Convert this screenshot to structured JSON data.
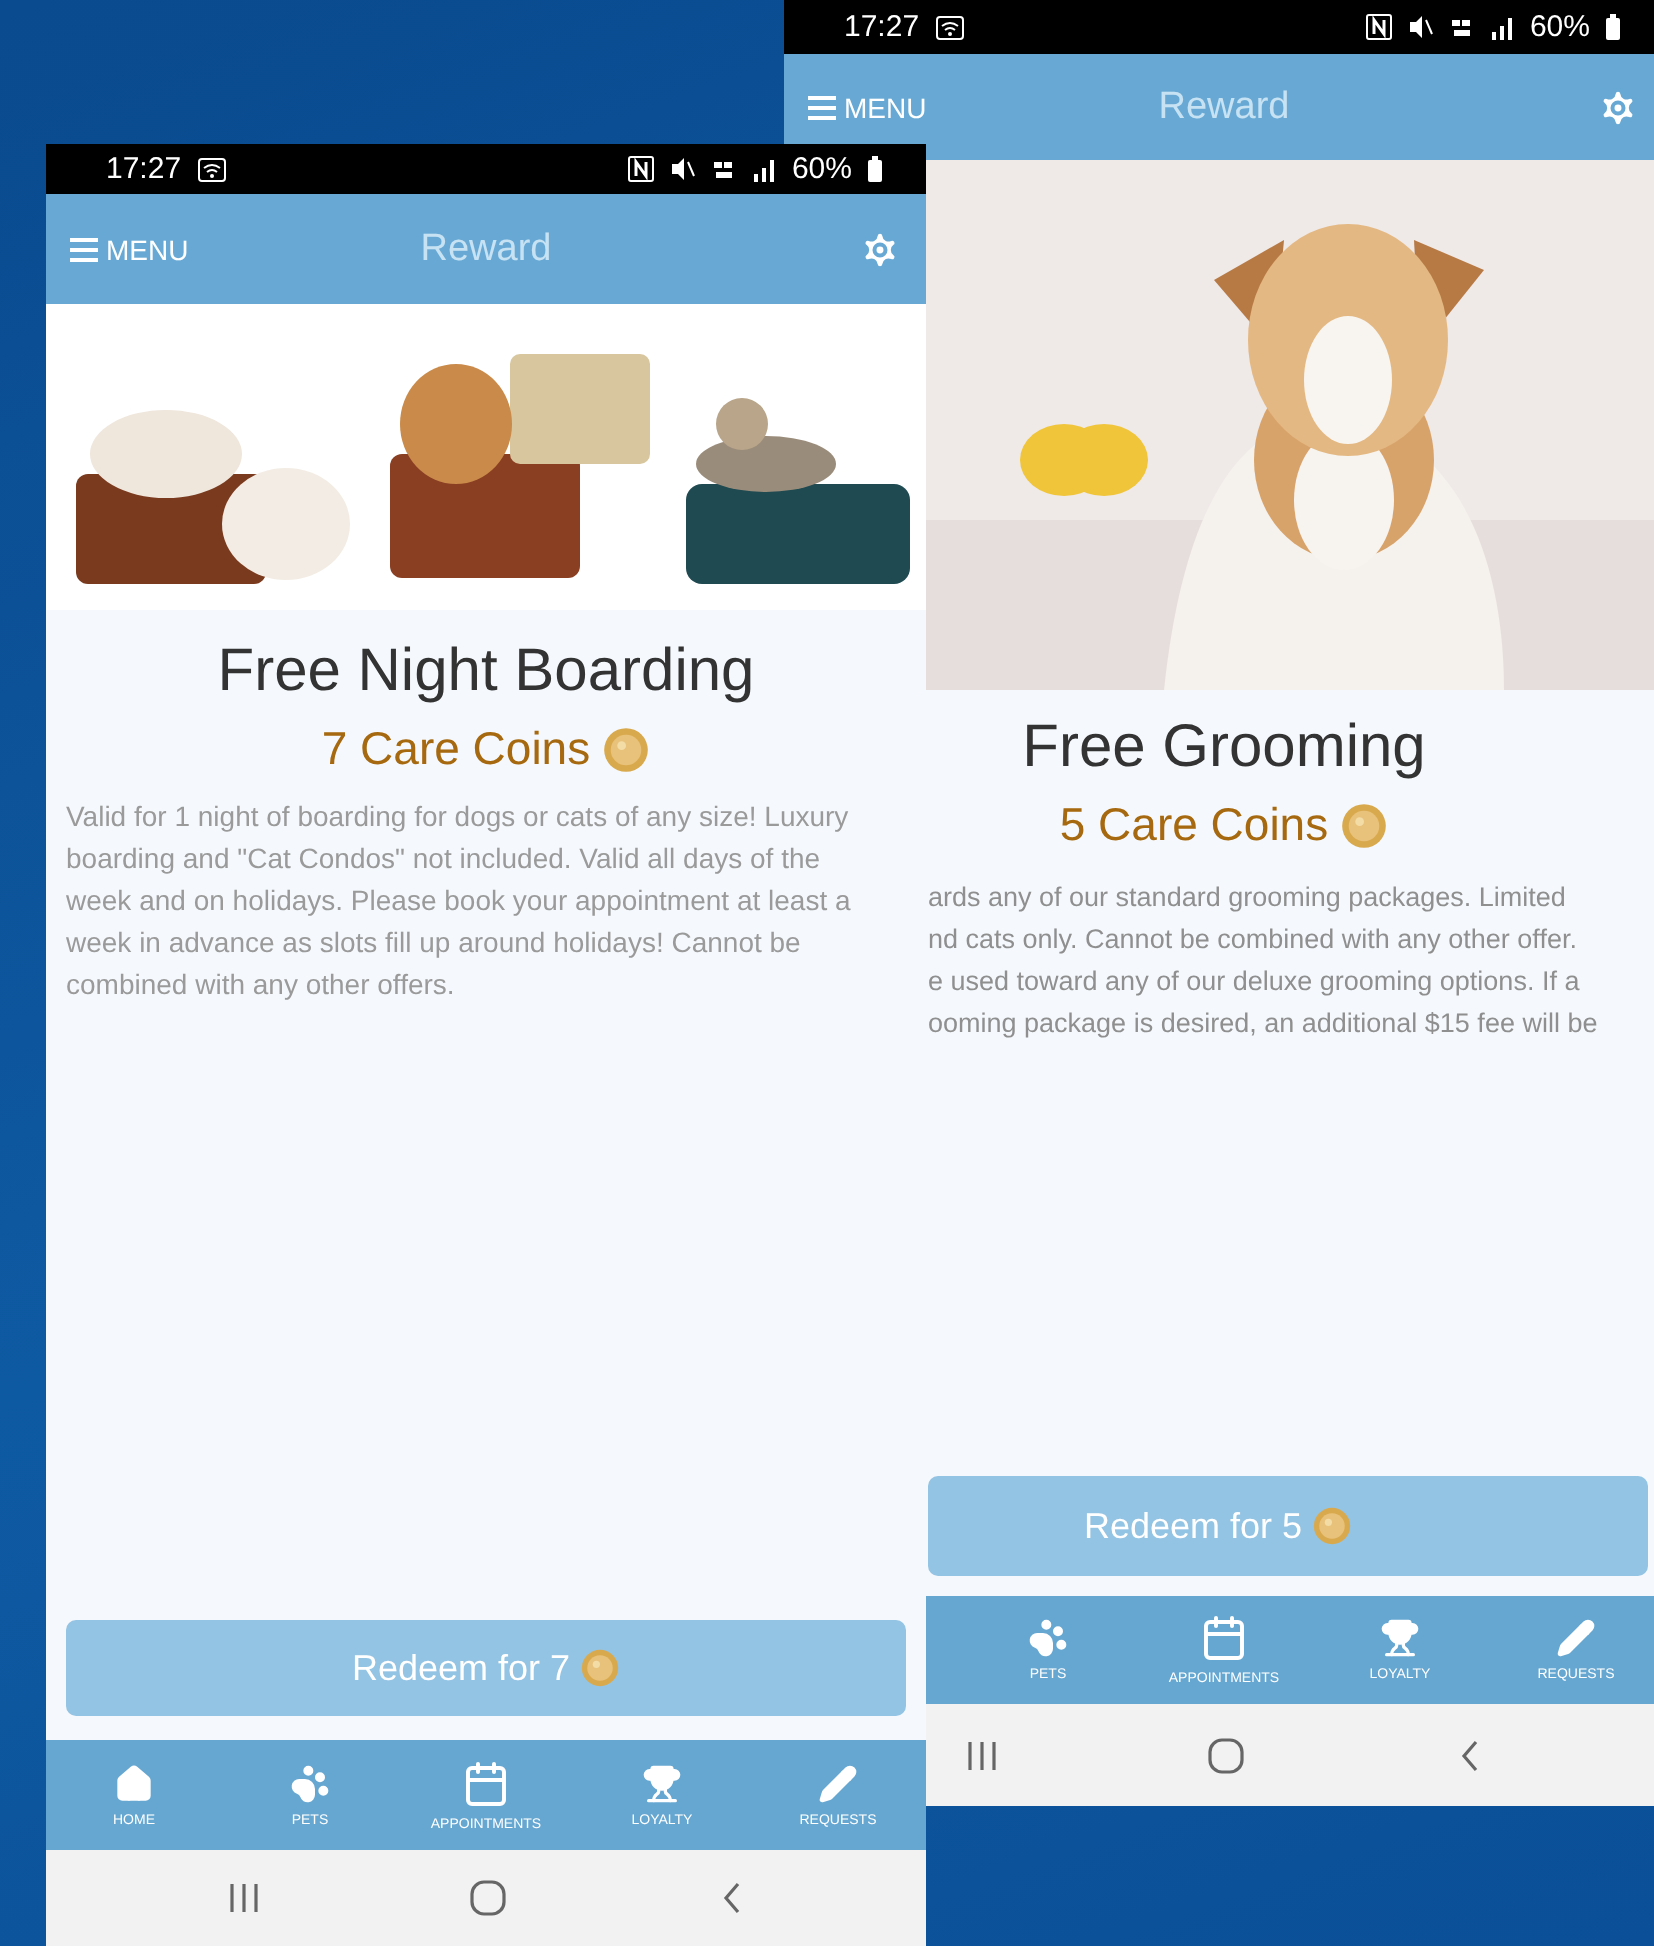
{
  "phones": [
    {
      "kind": "back",
      "status_bar": {
        "time": "17:27",
        "battery": "60%"
      },
      "header": {
        "menu": "MENU",
        "title": "Reward"
      },
      "reward": {
        "title": "Free Grooming",
        "cost": "5 Care Coins",
        "description_lines": [
          "ards any of our standard grooming packages. Limited",
          "nd cats only. Cannot be combined with any other offer.",
          "e used toward any of our deluxe grooming options. If a",
          "ooming package is desired, an additional $15 fee will be"
        ]
      },
      "redeem_button": "Redeem for 5",
      "nav": [
        {
          "kind": "pets",
          "label": "PETS"
        },
        {
          "kind": "appointments",
          "label": "APPOINTMENTS"
        },
        {
          "kind": "loyalty",
          "label": "LOYALTY"
        },
        {
          "kind": "requests",
          "label": "REQUESTS"
        }
      ]
    },
    {
      "kind": "front",
      "status_bar": {
        "time": "17:27",
        "battery": "60%"
      },
      "header": {
        "menu": "MENU",
        "title": "Reward"
      },
      "reward": {
        "title": "Free Night Boarding",
        "cost": "7 Care Coins",
        "description": "Valid for 1 night of boarding for dogs or cats of any size! Luxury boarding and \"Cat Condos\" not included. Valid all days of the week and on holidays. Please book your appointment at least a week in advance as slots fill up around holidays! Cannot be combined with any other offers."
      },
      "redeem_button": "Redeem for 7",
      "nav": [
        {
          "kind": "home",
          "label": "HOME"
        },
        {
          "kind": "pets",
          "label": "PETS"
        },
        {
          "kind": "appointments",
          "label": "APPOINTMENTS"
        },
        {
          "kind": "loyalty",
          "label": "LOYALTY"
        },
        {
          "kind": "requests",
          "label": "REQUESTS"
        }
      ]
    }
  ]
}
